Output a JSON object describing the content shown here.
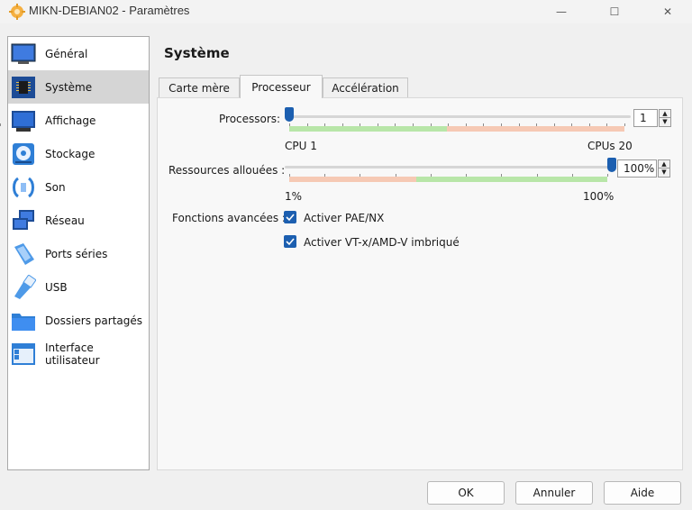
{
  "window": {
    "title": "MIKN-DEBIAN02 - Paramètres",
    "minimize_glyph": "—",
    "maximize_glyph": "☐",
    "close_glyph": "✕"
  },
  "sidebar": {
    "items": [
      {
        "label": "Général",
        "icon": "monitor-icon",
        "selected": false
      },
      {
        "label": "Système",
        "icon": "chip-icon",
        "selected": true
      },
      {
        "label": "Affichage",
        "icon": "display-icon",
        "selected": false
      },
      {
        "label": "Stockage",
        "icon": "disk-icon",
        "selected": false
      },
      {
        "label": "Son",
        "icon": "speaker-icon",
        "selected": false
      },
      {
        "label": "Réseau",
        "icon": "network-icon",
        "selected": false
      },
      {
        "label": "Ports séries",
        "icon": "serial-port-icon",
        "selected": false
      },
      {
        "label": "USB",
        "icon": "usb-icon",
        "selected": false
      },
      {
        "label": "Dossiers partagés",
        "icon": "folder-icon",
        "selected": false
      },
      {
        "label": "Interface utilisateur",
        "icon": "ui-window-icon",
        "selected": false
      }
    ]
  },
  "main": {
    "title": "Système",
    "tabs": [
      {
        "label": "Carte mère",
        "active": false
      },
      {
        "label": "Processeur",
        "active": true
      },
      {
        "label": "Accélération",
        "active": false
      }
    ],
    "processors": {
      "label": "Processors:",
      "value": "1",
      "value_numeric": 1,
      "min_label": "CPU 1",
      "max_label": "CPUs 20",
      "min": 1,
      "max": 20
    },
    "resources": {
      "label": "Ressources allouées :",
      "value": "100%",
      "value_numeric": 100,
      "min_label": "1%",
      "max_label": "100%",
      "min": 1,
      "max": 100
    },
    "advanced": {
      "label": "Fonctions avancées :",
      "options": [
        {
          "label": "Activer PAE/NX",
          "checked": true
        },
        {
          "label": "Activer VT-x/AMD-V imbriqué",
          "checked": true
        }
      ]
    }
  },
  "buttons": {
    "ok": "OK",
    "cancel": "Annuler",
    "help": "Aide"
  },
  "colors": {
    "accent": "#1c5fb0",
    "safe_band": "#b8e6a8",
    "warn_band": "#f6c9b4",
    "selected_bg": "#d5d5d5"
  }
}
